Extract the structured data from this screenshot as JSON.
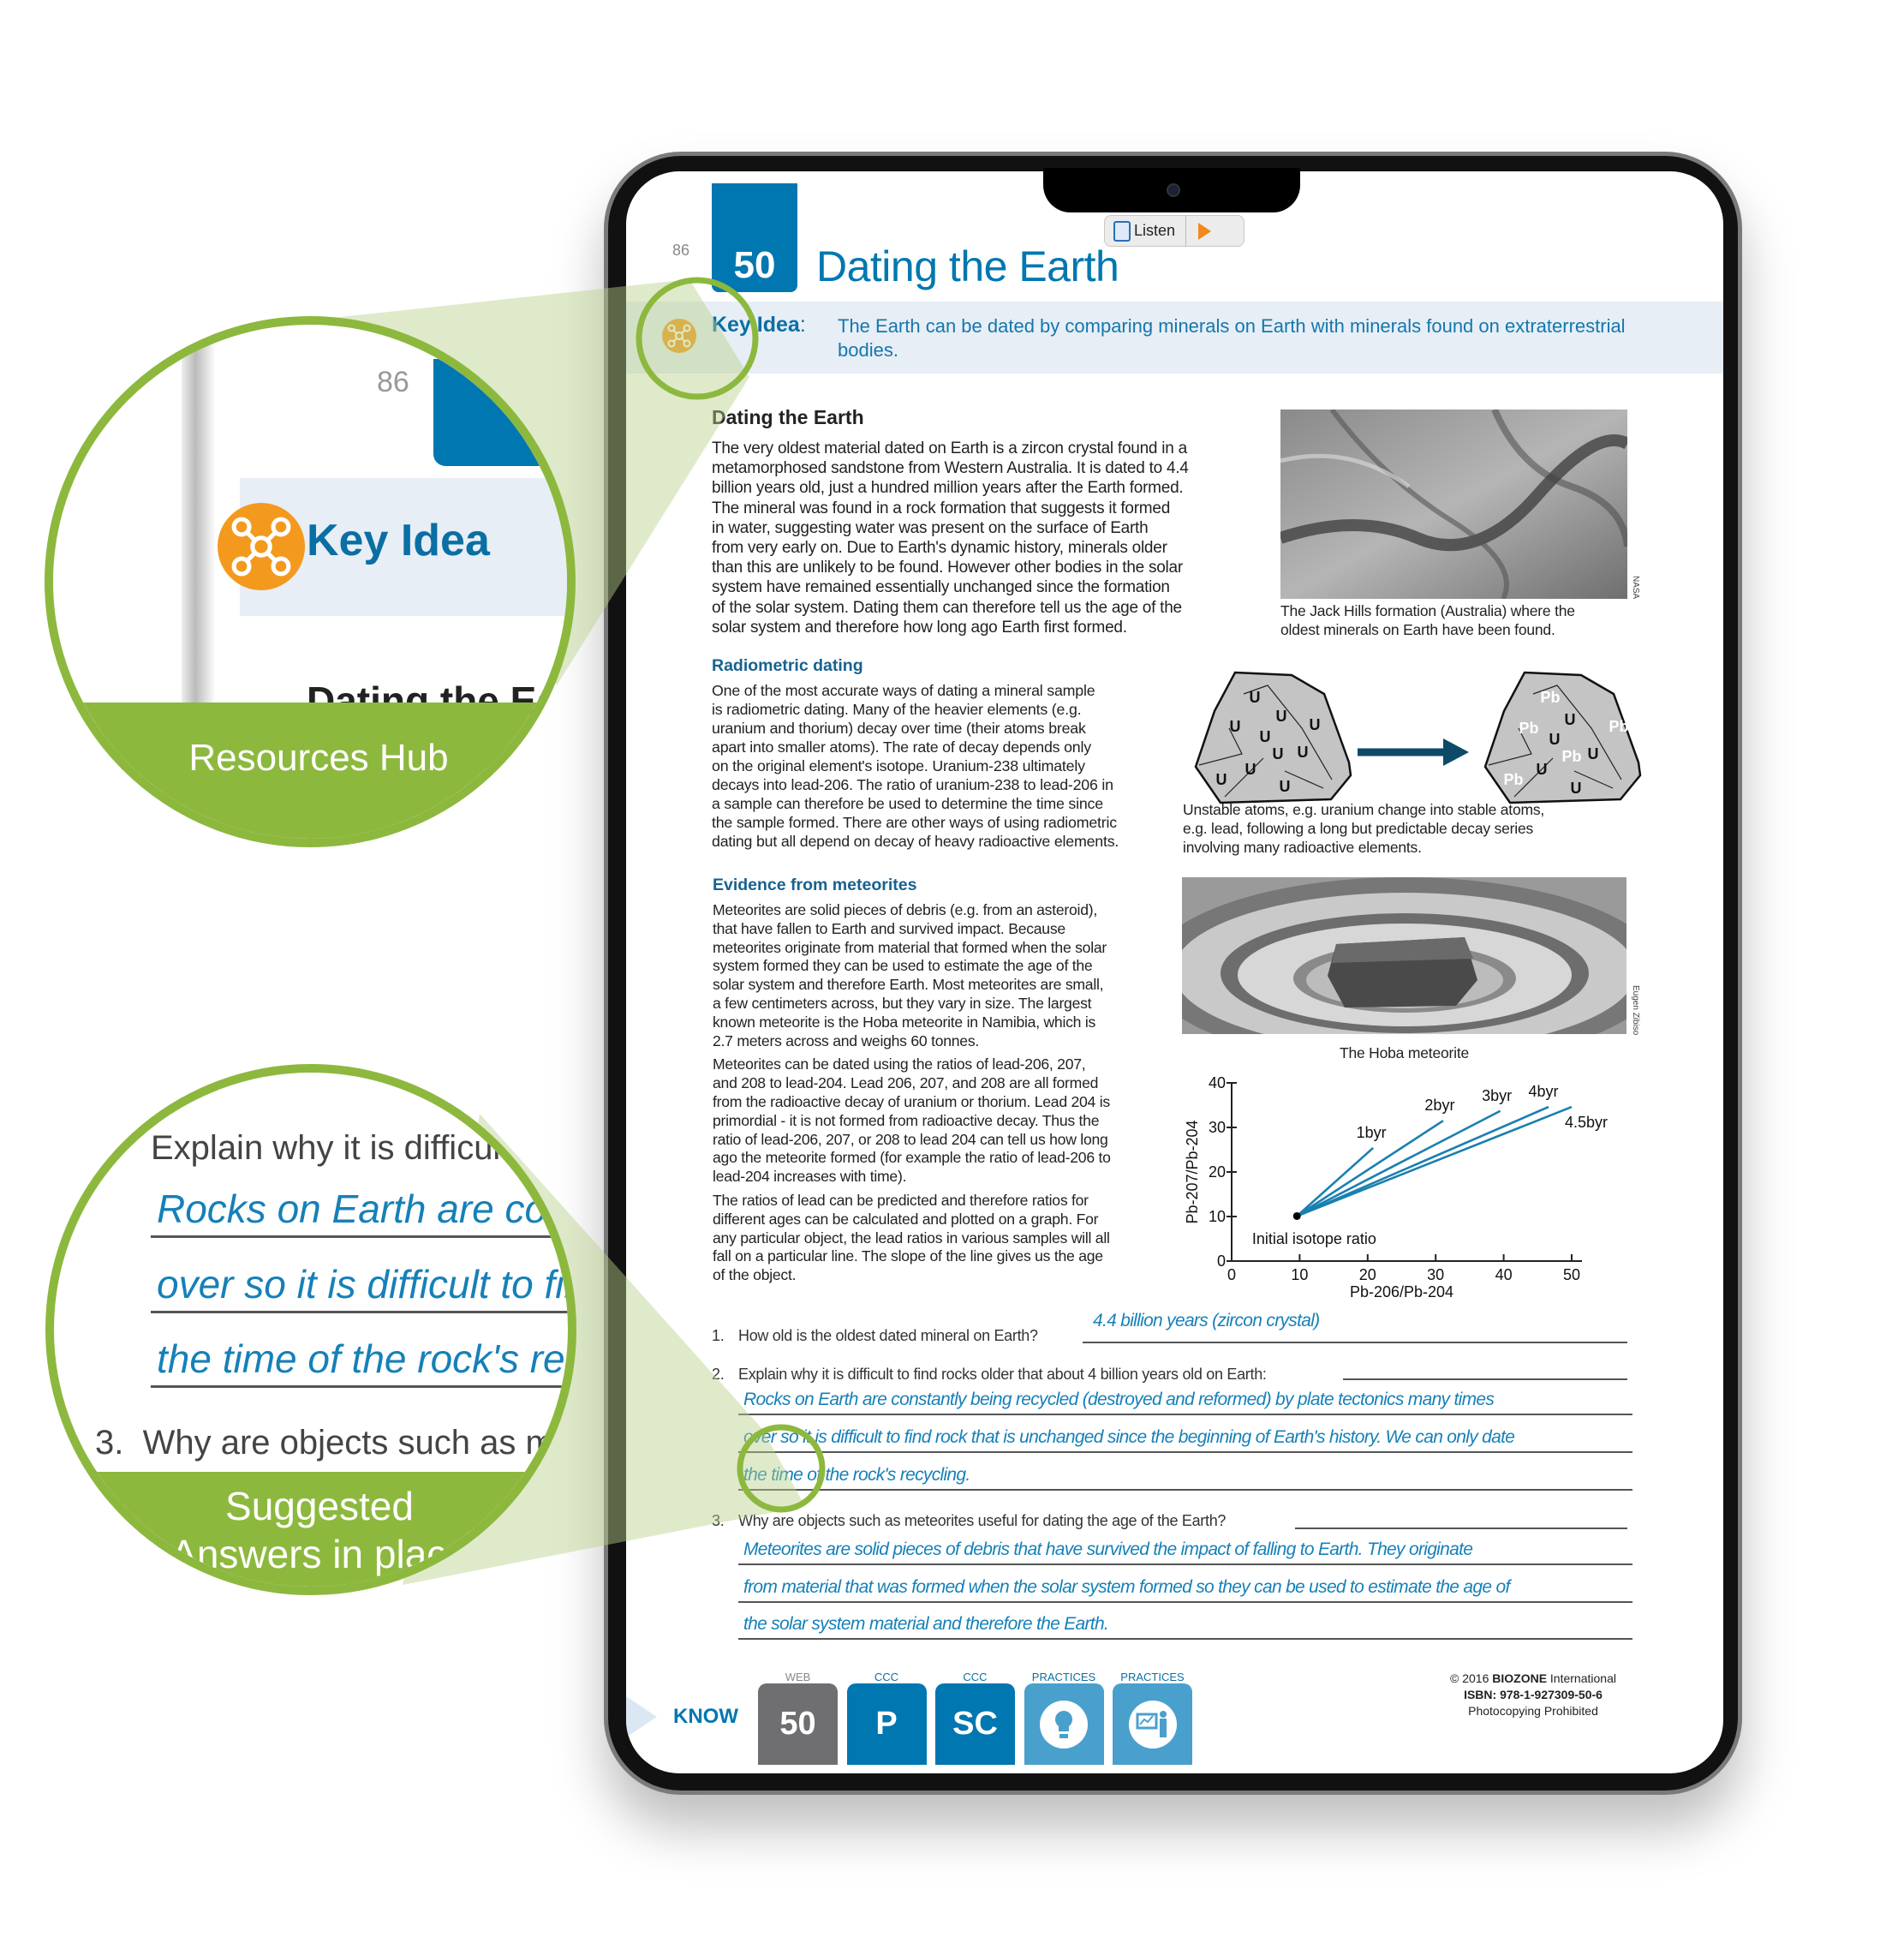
{
  "page": {
    "number": "86",
    "activity_number": "50",
    "title": "Dating the Earth",
    "listen_label": "Listen"
  },
  "key_idea": {
    "label": "Key Idea",
    "colon": ":",
    "text": "The Earth can be dated by comparing minerals on Earth with minerals found on extraterrestrial bodies."
  },
  "section1": {
    "heading": "Dating the Earth",
    "lines": [
      "The very oldest material dated on Earth is a zircon crystal found in a",
      "metamorphosed sandstone from Western Australia. It is dated to 4.4",
      "billion years old, just a hundred million years after the Earth formed.",
      "The mineral was found in a rock formation that suggests it formed",
      "in water, suggesting water was present on the surface of Earth",
      "from very early on. Due to Earth's dynamic history, minerals older",
      "than this are unlikely to be found. However other bodies in the solar",
      "system have remained essentially unchanged since the formation",
      "of the solar system. Dating them can therefore tell us the age of the",
      "solar system and therefore how long ago Earth first formed."
    ],
    "image_caption": [
      "The Jack Hills formation (Australia) where the",
      "oldest minerals on Earth have been found."
    ],
    "image_credit": "NASA"
  },
  "section2": {
    "heading": "Radiometric dating",
    "lines": [
      "One of the most accurate ways of dating a mineral sample",
      "is radiometric dating. Many of the heavier elements (e.g.",
      "uranium and thorium) decay over time (their atoms break",
      "apart into smaller atoms). The rate of decay depends only",
      "on the original element's isotope. Uranium-238 ultimately",
      "decays into lead-206. The ratio of uranium-238 to lead-206 in",
      "a sample can therefore be used to determine the time since",
      "the sample formed. There are other ways of using radiometric",
      "dating but all depend on decay of heavy radioactive elements."
    ],
    "diagram": {
      "uranium_label": "U",
      "lead_label": "Pb"
    },
    "diagram_caption": [
      "Unstable atoms, e.g. uranium change into stable atoms,",
      "e.g. lead, following a long but predictable decay series",
      "involving many radioactive elements."
    ]
  },
  "section3": {
    "heading": "Evidence from meteorites",
    "lines": [
      "Meteorites are solid pieces of debris (e.g. from an asteroid),",
      "that have fallen to Earth and survived impact. Because",
      "meteorites originate from material that formed when the solar",
      "system formed they can be used to estimate the age of the",
      "solar system and therefore Earth. Most meteorites are small,",
      "a few centimeters across, but they vary in size. The largest",
      "known meteorite is the Hoba meteorite in Namibia, which is",
      "2.7 meters across and weighs 60 tonnes.",
      "",
      "Meteorites can be dated using the ratios of lead-206, 207,",
      "and 208 to lead-204. Lead 206, 207, and 208 are all formed",
      "from the radioactive decay of uranium or thorium. Lead 204 is",
      "primordial - it is not formed from radioactive decay. Thus the",
      "ratio of lead-206, 207, or 208 to lead 204 can tell us how long",
      "ago the meteorite formed (for example the ratio of lead-206 to",
      "lead-204 increases with time).",
      "",
      "The ratios of lead can be predicted and therefore ratios for",
      "different ages can be calculated and plotted on a graph. For",
      "any particular object, the lead ratios in various samples will all",
      "fall on a particular line. The slope of the line gives us the age",
      "of the object."
    ],
    "image_caption": "The Hoba meteorite",
    "image_credit": "Eugen Zibiso"
  },
  "chart_data": {
    "type": "line",
    "xlabel": "Pb-206/Pb-204",
    "ylabel": "Pb-207/Pb-204",
    "xlim": [
      0,
      50
    ],
    "ylim": [
      0,
      40
    ],
    "xticks": [
      0,
      10,
      20,
      30,
      40,
      50
    ],
    "yticks": [
      0,
      10,
      20,
      30,
      40
    ],
    "grid": false,
    "origin_point": {
      "x": 9.6,
      "y": 10.1,
      "label": "Initial isotope ratio"
    },
    "series": [
      {
        "name": "1byr",
        "x": [
          9.6,
          20.8
        ],
        "y": [
          10.1,
          25.4
        ]
      },
      {
        "name": "2byr",
        "x": [
          9.6,
          31.1
        ],
        "y": [
          10.1,
          31.5
        ]
      },
      {
        "name": "3byr",
        "x": [
          9.6,
          39.5
        ],
        "y": [
          10.1,
          33.7
        ]
      },
      {
        "name": "4byr",
        "x": [
          9.6,
          46.6
        ],
        "y": [
          10.1,
          34.6
        ]
      },
      {
        "name": "4.5byr",
        "x": [
          9.6,
          50.0
        ],
        "y": [
          10.1,
          34.6
        ]
      }
    ],
    "line_color": "#1a7fb0"
  },
  "questions": [
    {
      "number": "1.",
      "text": "How old is the oldest dated mineral on Earth?",
      "answer": [
        "4.4 billion years (zircon crystal)"
      ]
    },
    {
      "number": "2.",
      "text": "Explain why it is difficult to find rocks older that about 4 billion years old on Earth:",
      "answer": [
        "Rocks on Earth are constantly being recycled (destroyed and reformed) by plate tectonics many times",
        "over so it is difficult to find rock that is unchanged since the beginning of Earth's history. We can only date",
        "the time of the rock's recycling."
      ]
    },
    {
      "number": "3.",
      "text": "Why are objects such as meteorites useful for dating the age of the Earth?",
      "answer": [
        "Meteorites are solid pieces of debris that have survived the impact of falling to Earth. They originate",
        "from material that was formed when the solar system formed so they can be used to estimate the age of",
        "the solar system material and therefore the Earth."
      ]
    }
  ],
  "footer": {
    "know_label": "KNOW",
    "tiles": [
      {
        "label": "WEB",
        "value": "50",
        "color": "#6f6f72"
      },
      {
        "label": "CCC",
        "value": "P",
        "color": "#0077b0"
      },
      {
        "label": "CCC",
        "value": "SC",
        "color": "#0077b0"
      },
      {
        "label": "PRACTICES",
        "icon": "lightbulb-icon",
        "color": "#4aa0cc"
      },
      {
        "label": "PRACTICES",
        "icon": "presenter-chart-icon",
        "color": "#4aa0cc"
      }
    ],
    "copyright_prefix": "© 2016 ",
    "publisher": "BIOZONE",
    "copyright_suffix": " International",
    "isbn": "ISBN: 978-1-927309-50-6",
    "notice": "Photocopying Prohibited"
  },
  "callouts": {
    "resources_hub": "Resources Hub",
    "suggested_answers": [
      "Suggested",
      "Answers in place"
    ],
    "accent_color": "#8db83e"
  }
}
